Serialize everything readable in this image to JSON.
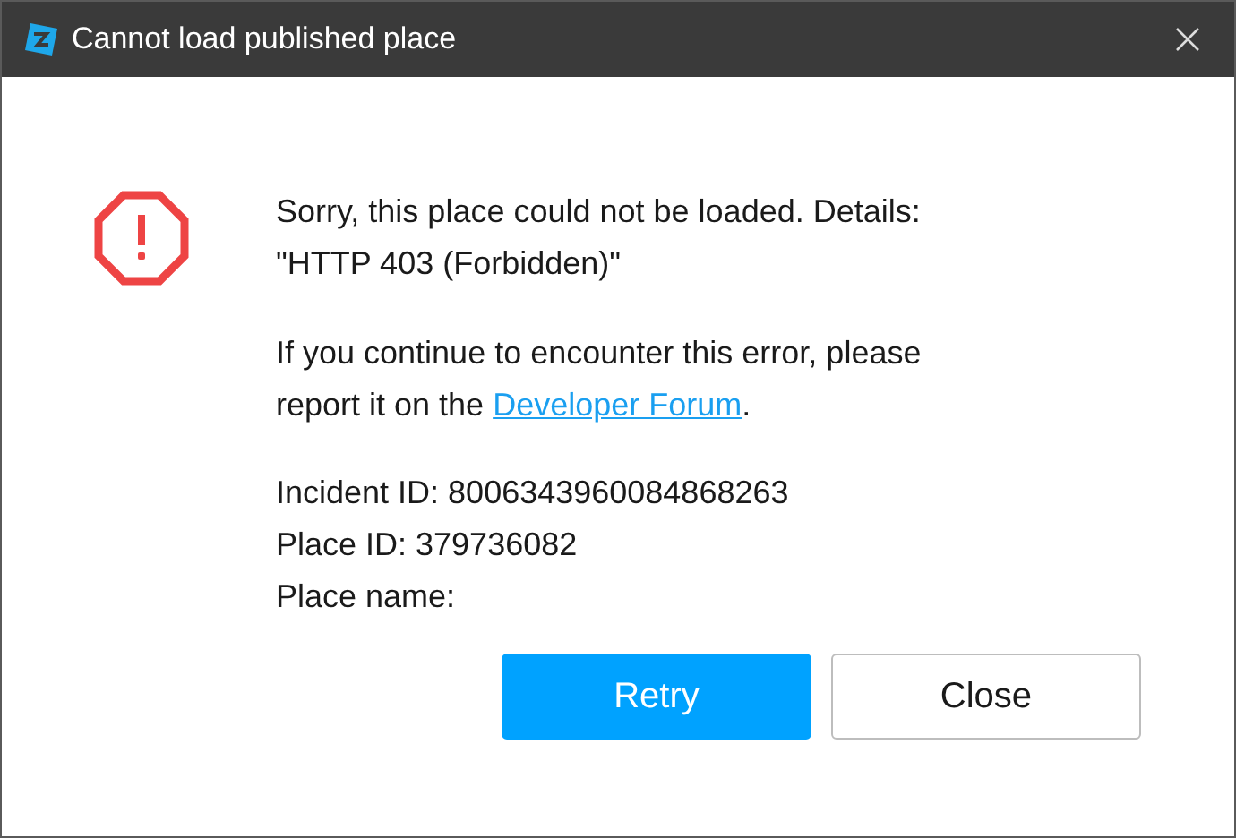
{
  "window": {
    "title": "Cannot load published place"
  },
  "message": {
    "lines": [
      "Sorry, this place could not be loaded. Details:",
      "\"HTTP 403 (Forbidden)\""
    ]
  },
  "help": {
    "lines": [
      "If you continue to encounter this error, please",
      "report it on the "
    ],
    "link": "Developer Forum",
    "after": "."
  },
  "details": [
    "Incident ID: 8006343960084868263",
    "Place ID: 379736082",
    "Place name:"
  ],
  "buttons": [
    {
      "label": "Retry",
      "kind": "primary"
    },
    {
      "label": "Close",
      "kind": "secondary"
    }
  ]
}
